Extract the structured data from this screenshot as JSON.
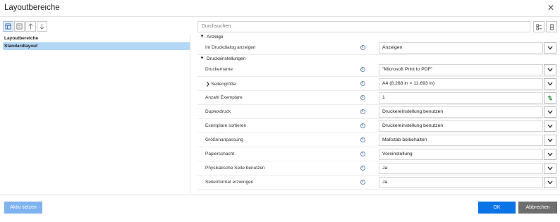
{
  "window": {
    "title": "Layoutbereiche"
  },
  "left": {
    "items": [
      {
        "label": "Layoutbereiche",
        "selected": false
      },
      {
        "label": "Standardlayout",
        "selected": true
      }
    ]
  },
  "search": {
    "placeholder": "Durchsuchen"
  },
  "sections": {
    "anzeige": "Anzeige",
    "druckeinstellungen": "Druckeinstellungen"
  },
  "rows": [
    {
      "label": "Im Druckdialog anzeigen",
      "value": "Anzeigen",
      "control": "dropdown"
    },
    {
      "label": "Druckername",
      "value": "\"Microsoft Print to PDF\"",
      "control": "dropdown"
    },
    {
      "label": "Seitengröße",
      "value": "A4 (8.268 in × 11.693 in)",
      "control": "dropdown"
    },
    {
      "label": "Anzahl Exemplare",
      "value": "1",
      "control": "number"
    },
    {
      "label": "Duplexdruck",
      "value": "Druckereinstellung benutzen",
      "control": "dropdown"
    },
    {
      "label": "Exemplare sortieren",
      "value": "Druckereinstellung benutzen",
      "control": "dropdown"
    },
    {
      "label": "Größenanpassung",
      "value": "Maßstab beibehalten",
      "control": "dropdown"
    },
    {
      "label": "Papierschacht",
      "value": "Voreinstellung",
      "control": "dropdown"
    },
    {
      "label": "Physikalische Seite benutzen",
      "value": "Ja",
      "control": "dropdown"
    },
    {
      "label": "Seitenformat erzwingen",
      "value": "Ja",
      "control": "dropdown"
    }
  ],
  "buttons": {
    "apply": "Aktiv setzen",
    "ok": "OK",
    "cancel": "Abbrechen"
  },
  "colors": {
    "accent": "#0a74e7",
    "apply": "#7fb3ef",
    "cancel": "#6e6e6e",
    "selection": "#b5d7f6"
  }
}
